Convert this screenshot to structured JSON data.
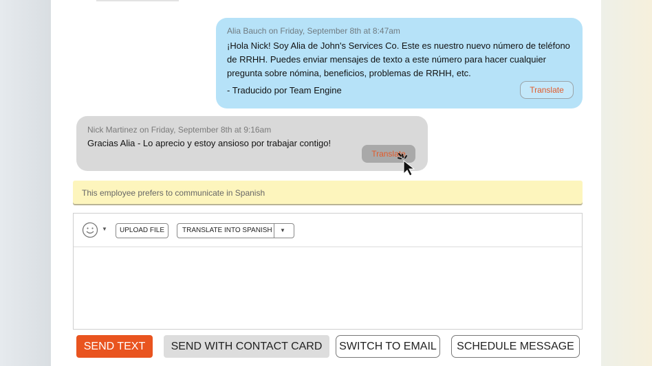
{
  "conversation": {
    "outgoing": {
      "meta": "Alia Bauch on Friday, September 8th at 8:47am",
      "text": "¡Hola Nick! Soy Alia de John's Services Co. Este es nuestro nuevo número de teléfono de RRHH. Puedes enviar mensajes de texto a este número para hacer cualquier pregunta sobre nómina, beneficios, problemas de RRHH, etc.",
      "signature": "- Traducido por Team Engine",
      "translate_label": "Translate"
    },
    "incoming": {
      "meta": "Nick Martinez on Friday, September 8th at 9:16am",
      "text": "Gracias Alia - Lo aprecio y estoy ansioso por trabajar contigo!",
      "translate_label": "Translate"
    }
  },
  "notice": "This employee prefers to communicate in Spanish",
  "composer": {
    "emoji_icon": "smiley-icon",
    "upload_label": "UPLOAD FILE",
    "translate_select": "TRANSLATE INTO SPANISH",
    "message_value": ""
  },
  "actions": {
    "send": "SEND TEXT",
    "contact": "SEND WITH CONTACT CARD",
    "email": "SWITCH TO EMAIL",
    "schedule": "SCHEDULE MESSAGE"
  },
  "colors": {
    "accent": "#e9541f",
    "outgoing_bubble": "#b6e2f8",
    "incoming_bubble": "#d9d9d9",
    "notice_bg": "#fdf5bd"
  }
}
